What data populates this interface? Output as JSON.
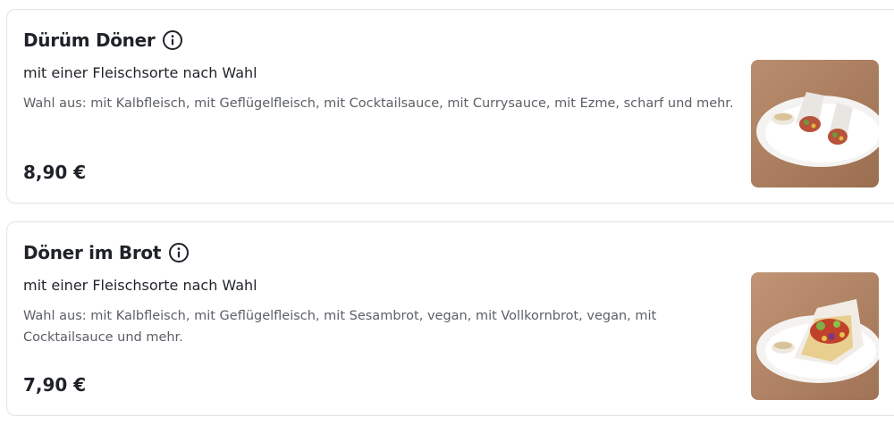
{
  "items": [
    {
      "title": "Dürüm Döner",
      "subtitle": "mit einer Fleischsorte nach Wahl",
      "choices": "Wahl aus: mit Kalbfleisch, mit Geflügelfleisch, mit Cocktailsauce, mit Currysauce, mit Ezme, scharf und mehr.",
      "price": "8,90 €",
      "icon": "info-icon",
      "image": "durum-doner-photo"
    },
    {
      "title": "Döner im Brot",
      "subtitle": "mit einer Fleischsorte nach Wahl",
      "choices": "Wahl aus: mit Kalbfleisch, mit Geflügelfleisch, mit Sesambrot, vegan, mit Vollkornbrot, vegan, mit Cocktailsauce und mehr.",
      "price": "7,90 €",
      "icon": "info-icon",
      "image": "doner-im-brot-photo"
    }
  ],
  "colors": {
    "text": "#1f2329",
    "muted": "#5b5f66",
    "border": "#e3e3e3"
  }
}
